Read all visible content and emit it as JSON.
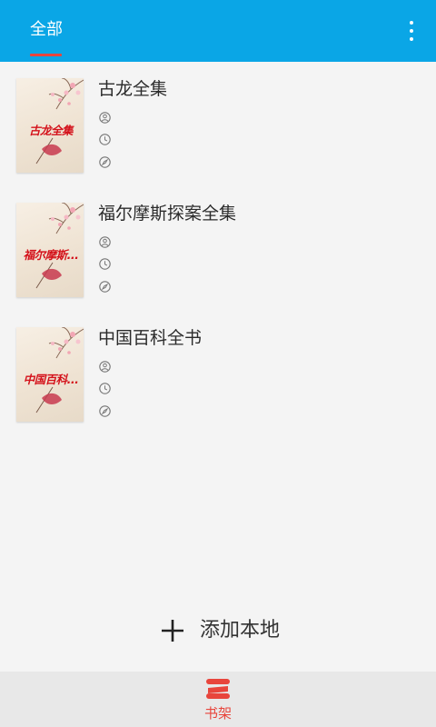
{
  "header": {
    "tab_all_label": "全部",
    "more_icon": "more-vertical-icon",
    "background": "#0aa6e6",
    "indicator_color": "#e8453c"
  },
  "books": [
    {
      "title": "古龙全集",
      "cover_text": "古龙全集"
    },
    {
      "title": "福尔摩斯探案全集",
      "cover_text": "福尔摩斯..."
    },
    {
      "title": "中国百科全书",
      "cover_text": "中国百科..."
    }
  ],
  "meta_icons": [
    "person-icon",
    "clock-icon",
    "compass-icon"
  ],
  "add_local": {
    "label": "添加本地",
    "icon": "plus-icon"
  },
  "bottom_nav": {
    "bookshelf_label": "书架",
    "active_color": "#e8453c"
  }
}
